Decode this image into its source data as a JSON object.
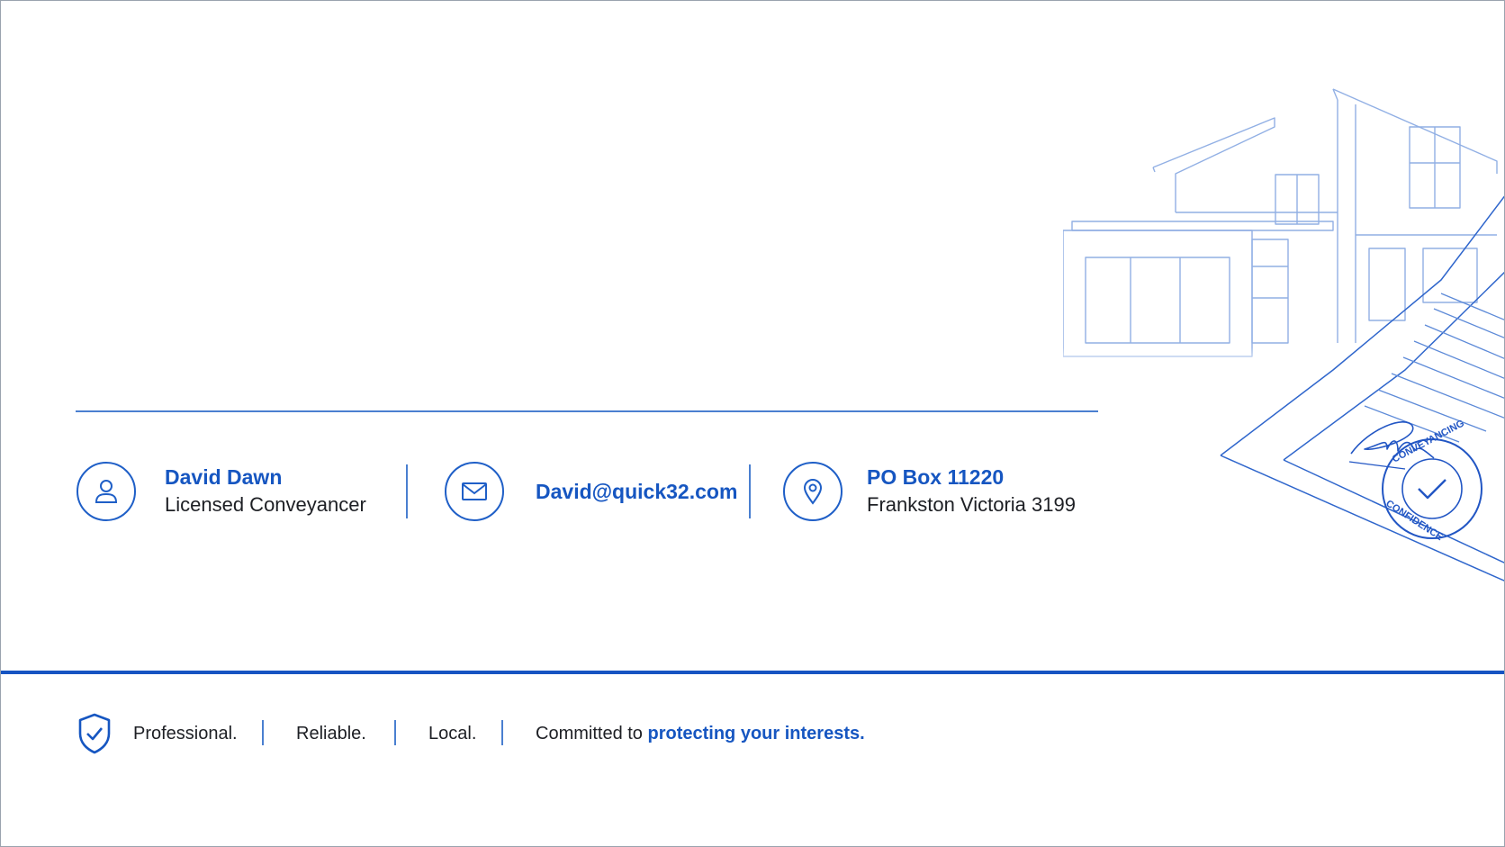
{
  "contacts": {
    "person": {
      "name": "David Dawn",
      "role": "Licensed Conveyancer",
      "icon": "user-icon"
    },
    "email": {
      "address": "David@quick32.com",
      "icon": "envelope-icon"
    },
    "address": {
      "line1": "PO Box 11220",
      "line2": "Frankston Victoria 3199",
      "icon": "map-pin-icon"
    }
  },
  "illustration": {
    "stamp_top": "CONVEYANCING",
    "stamp_bottom": "CONFIDENCE"
  },
  "footer": {
    "icon": "shield-check-icon",
    "words": [
      "Professional.",
      "Reliable.",
      "Local."
    ],
    "tagline_prefix": "Committed to",
    "tagline_highlight": "protecting your interests."
  },
  "colors": {
    "accent": "#1656c1",
    "line": "#4a7fd0",
    "text": "#1d1f24",
    "sketch": "#8fb0e6"
  }
}
